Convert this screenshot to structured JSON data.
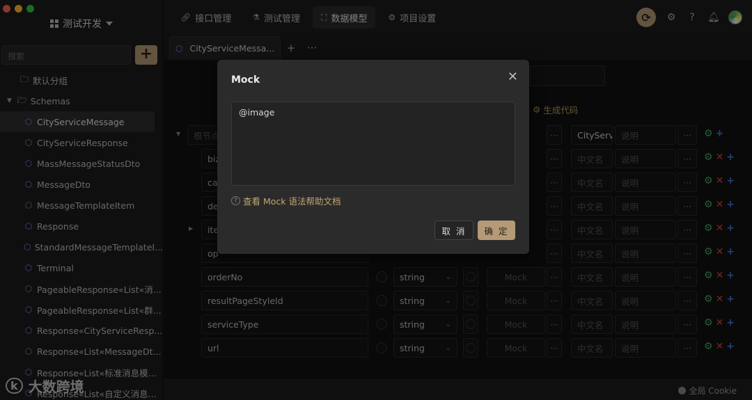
{
  "project": {
    "name": "测试开发"
  },
  "sidebar": {
    "search_placeholder": "搜索",
    "add_label": "+",
    "items": [
      {
        "label": "默认分组",
        "kind": "folder"
      },
      {
        "label": "Schemas",
        "kind": "folder-open"
      },
      {
        "label": "CityServiceMessage",
        "kind": "schema",
        "active": true
      },
      {
        "label": "CityServiceResponse",
        "kind": "schema"
      },
      {
        "label": "MassMessageStatusDto",
        "kind": "schema"
      },
      {
        "label": "MessageDto",
        "kind": "schema"
      },
      {
        "label": "MessageTemplateItem",
        "kind": "schema"
      },
      {
        "label": "Response",
        "kind": "schema"
      },
      {
        "label": "StandardMessageTemplateI...",
        "kind": "schema"
      },
      {
        "label": "Terminal",
        "kind": "schema"
      },
      {
        "label": "PageableResponse«List«消...",
        "kind": "schema"
      },
      {
        "label": "PageableResponse«List«群...",
        "kind": "schema"
      },
      {
        "label": "Response«CityServiceResp...",
        "kind": "schema"
      },
      {
        "label": "Response«List«MessageDt...",
        "kind": "schema"
      },
      {
        "label": "Response«List«标准消息模...",
        "kind": "schema"
      },
      {
        "label": "Response«List«自定义消息...",
        "kind": "schema"
      }
    ]
  },
  "topnav": {
    "tabs": [
      {
        "label": "接口管理",
        "icon": "link-icon"
      },
      {
        "label": "测试管理",
        "icon": "flask-icon"
      },
      {
        "label": "数据模型",
        "icon": "model-icon",
        "active": true
      },
      {
        "label": "项目设置",
        "icon": "gear-icon"
      }
    ]
  },
  "tabstrip": {
    "doc_tab": "CityServiceMessa...",
    "new_tab": "+",
    "more": "···"
  },
  "main": {
    "gen_code": "生成代码",
    "root_placeholder": "根节点",
    "root_value": "CityServ",
    "placeholders": {
      "cn": "中文名",
      "desc": "说明",
      "mock": "Mock"
    },
    "partial_rows": [
      "biz",
      "ca",
      "de",
      "ite",
      "op"
    ],
    "rows": [
      {
        "name": "orderNo",
        "type": "string"
      },
      {
        "name": "resultPageStyleId",
        "type": "string"
      },
      {
        "name": "serviceType",
        "type": "string"
      },
      {
        "name": "url",
        "type": "string"
      }
    ]
  },
  "footer": {
    "cookie": "全局 Cookie"
  },
  "modal": {
    "title": "Mock",
    "value": "@image",
    "help": "查看 Mock 语法帮助文档",
    "cancel": "取 消",
    "ok": "确 定"
  },
  "watermark": {
    "logo": "k",
    "text": "大数跨境"
  },
  "colors": {
    "accent": "#b49a76",
    "gear": "#47a869",
    "delete": "#d8433b",
    "add": "#3a78d8",
    "link": "#c4a672"
  }
}
